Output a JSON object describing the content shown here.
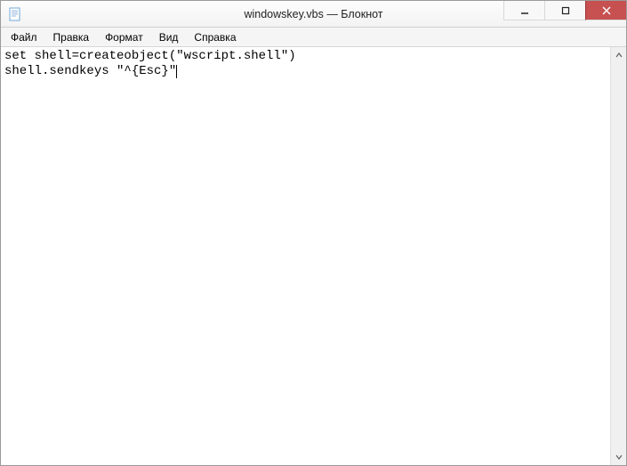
{
  "titlebar": {
    "title": "windowskey.vbs — Блокнот"
  },
  "menu": {
    "items": [
      {
        "label": "Файл"
      },
      {
        "label": "Правка"
      },
      {
        "label": "Формат"
      },
      {
        "label": "Вид"
      },
      {
        "label": "Справка"
      }
    ]
  },
  "editor": {
    "content": "set shell=createobject(\"wscript.shell\")\nshell.sendkeys \"^{Esc}\""
  }
}
